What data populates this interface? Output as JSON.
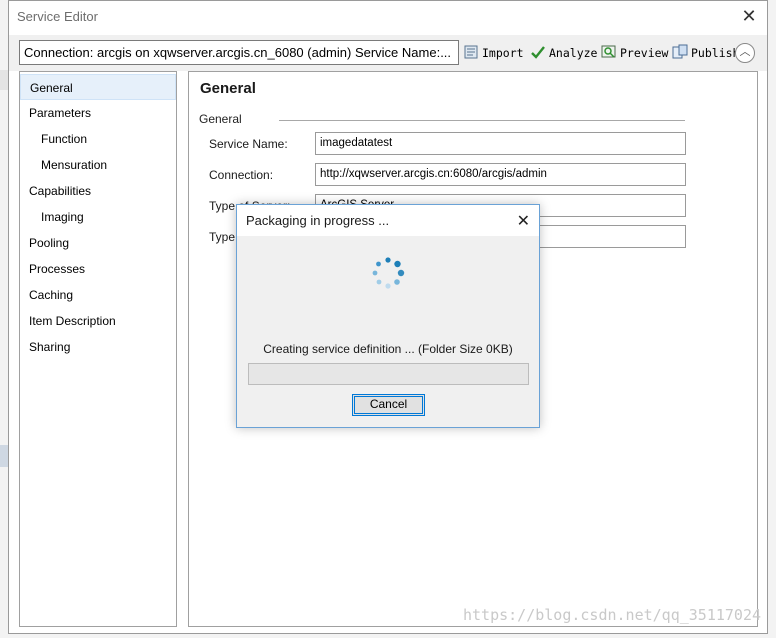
{
  "window": {
    "title": "Service Editor"
  },
  "toolbar": {
    "connection_text": "Connection: arcgis on xqwserver.arcgis.cn_6080 (admin)   Service Name:...",
    "import_label": "Import",
    "analyze_label": "Analyze",
    "preview_label": "Preview",
    "publish_label": "Publish"
  },
  "sidebar": {
    "items": [
      {
        "label": "General",
        "selected": true,
        "indent": 0
      },
      {
        "label": "Parameters",
        "indent": 0
      },
      {
        "label": "Function",
        "indent": 1
      },
      {
        "label": "Mensuration",
        "indent": 1
      },
      {
        "label": "Capabilities",
        "indent": 0
      },
      {
        "label": "Imaging",
        "indent": 1
      },
      {
        "label": "Pooling",
        "indent": 0
      },
      {
        "label": "Processes",
        "indent": 0
      },
      {
        "label": "Caching",
        "indent": 0
      },
      {
        "label": "Item Description",
        "indent": 0
      },
      {
        "label": "Sharing",
        "indent": 0
      }
    ]
  },
  "general": {
    "heading": "General",
    "group_label": "General",
    "fields": [
      {
        "label": "Service Name:",
        "value": "imagedatatest"
      },
      {
        "label": "Connection:",
        "value": "http://xqwserver.arcgis.cn:6080/arcgis/admin"
      },
      {
        "label": "Type of Server:",
        "value": "ArcGIS Server"
      },
      {
        "label": "Type",
        "value": ""
      }
    ]
  },
  "dialog": {
    "title": "Packaging in progress ...",
    "status": "Creating service definition ... (Folder Size 0KB)",
    "progress": 0,
    "cancel_label": "Cancel"
  },
  "watermark": "https://blog.csdn.net/qq_35117024",
  "colors": {
    "selection": "#e6f0fa",
    "accent": "#0078d7",
    "spinner": "#1e7fb8"
  }
}
